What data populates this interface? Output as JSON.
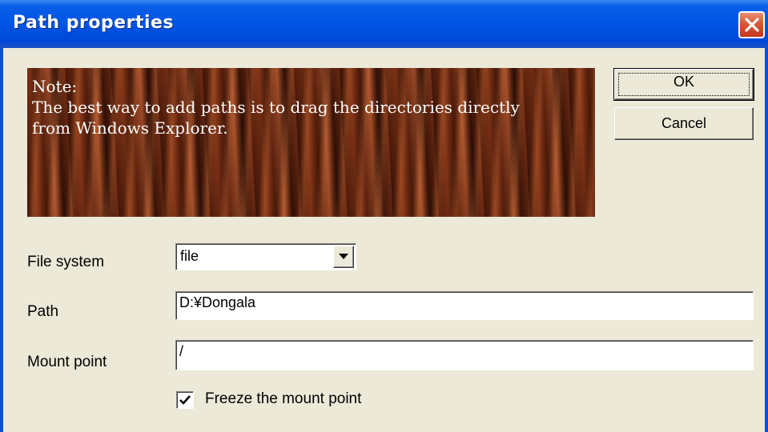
{
  "window": {
    "title": "Path properties"
  },
  "note": {
    "heading": "Note:",
    "line1": "The best way to add paths is to drag the directories directly",
    "line2": "from Windows Explorer."
  },
  "buttons": {
    "ok_label": "OK",
    "cancel_label": "Cancel"
  },
  "form": {
    "file_system_label": "File system",
    "file_system_value": "file",
    "path_label": "Path",
    "path_value": "D:¥Dongala",
    "mount_point_label": "Mount point",
    "mount_point_value": "/",
    "freeze_label": "Freeze the mount point",
    "freeze_checked": true
  },
  "icons": {
    "close": "close-icon",
    "dropdown": "chevron-down-icon",
    "check": "checkmark-icon"
  },
  "colors": {
    "title_bar": "#0055e5",
    "close_button": "#d8573a",
    "dialog_bg": "#ece9d8",
    "banner_wood": "#7a3016"
  }
}
